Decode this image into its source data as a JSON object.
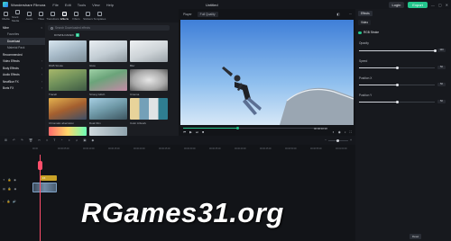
{
  "app": {
    "name": "Wondershare Filmora",
    "document_title": "Untitled",
    "menu": [
      "File",
      "Edit",
      "Tools",
      "View",
      "Help"
    ],
    "login_label": "Login",
    "export_label": "Export",
    "window_buttons": [
      "—",
      "▢",
      "✕"
    ]
  },
  "toolbar": {
    "tools": [
      {
        "label": "Media",
        "icon": "media-icon"
      },
      {
        "label": "Stock Media",
        "icon": "stock-media-icon"
      },
      {
        "label": "Audio",
        "icon": "audio-icon"
      },
      {
        "label": "Titles",
        "icon": "titles-icon"
      },
      {
        "label": "Transitions",
        "icon": "transitions-icon"
      },
      {
        "label": "Effects",
        "icon": "effects-icon",
        "active": true
      },
      {
        "label": "Filters",
        "icon": "filters-icon"
      },
      {
        "label": "Stickers",
        "icon": "stickers-icon"
      },
      {
        "label": "Templates",
        "icon": "templates-icon"
      }
    ]
  },
  "sidebar": {
    "items": [
      {
        "label": "Mine",
        "type": "head"
      },
      {
        "label": "Favorites",
        "type": "sub"
      },
      {
        "label": "Download",
        "type": "sub",
        "active": true
      },
      {
        "label": "Material Pack",
        "type": "sub"
      },
      {
        "label": "Recommended",
        "type": "head"
      },
      {
        "label": "Video Effects",
        "type": "head"
      },
      {
        "label": "Body Effects",
        "type": "head"
      },
      {
        "label": "Audio Effects",
        "type": "head"
      },
      {
        "label": "NewBlue FX",
        "type": "head"
      },
      {
        "label": "Boris FX",
        "type": "head"
      }
    ]
  },
  "media": {
    "search_placeholder": "Search Downloaded effects",
    "section_label": "DOWNLOADED",
    "section_count": "9",
    "thumbs": [
      {
        "label": "RGB Stroke",
        "style": "stroke"
      },
      {
        "label": "Glow",
        "style": "glow"
      },
      {
        "label": "Blur",
        "style": "blur"
      },
      {
        "label": "Tracell",
        "style": "tracell"
      },
      {
        "label": "Strong Glitch",
        "style": "glitch"
      },
      {
        "label": "Cinema",
        "style": "cinema"
      },
      {
        "label": "Chromatic aberration",
        "style": "chromatic"
      },
      {
        "label": "Dual Film",
        "style": "dual"
      },
      {
        "label": "Color Artwork",
        "style": "artwork"
      }
    ]
  },
  "player": {
    "tab_label": "Player",
    "quality_label": "Full Quality",
    "time": "00:00:02:10",
    "progress": 0.38
  },
  "properties": {
    "tab_effects": "Effects",
    "tab_video": "Video",
    "effect_name": "RGB Stroke",
    "params": [
      {
        "label": "Opacity",
        "value": "100",
        "level": 1.0
      },
      {
        "label": "Speed",
        "value": "50",
        "level": 0.5
      },
      {
        "label": "Position X",
        "value": "50",
        "level": 0.5
      },
      {
        "label": "Position Y",
        "value": "50",
        "level": 0.5
      }
    ],
    "reset_label": "Reset"
  },
  "timeline": {
    "ruler_ticks": [
      "00:00",
      "00:00:05:00",
      "00:00:10:00",
      "00:00:15:00",
      "00:00:20:00",
      "00:00:25:00",
      "00:00:30:00",
      "00:00:35:00",
      "00:00:40:00",
      "00:00:45:00",
      "00:00:50:00",
      "00:00:55:00",
      "00:01:00:00"
    ],
    "effect_clip_label": "FX"
  },
  "watermark": "RGames31.org",
  "colors": {
    "accent": "#24c58c",
    "playhead": "#ff4e6b",
    "effect_clip": "#c9a227"
  }
}
